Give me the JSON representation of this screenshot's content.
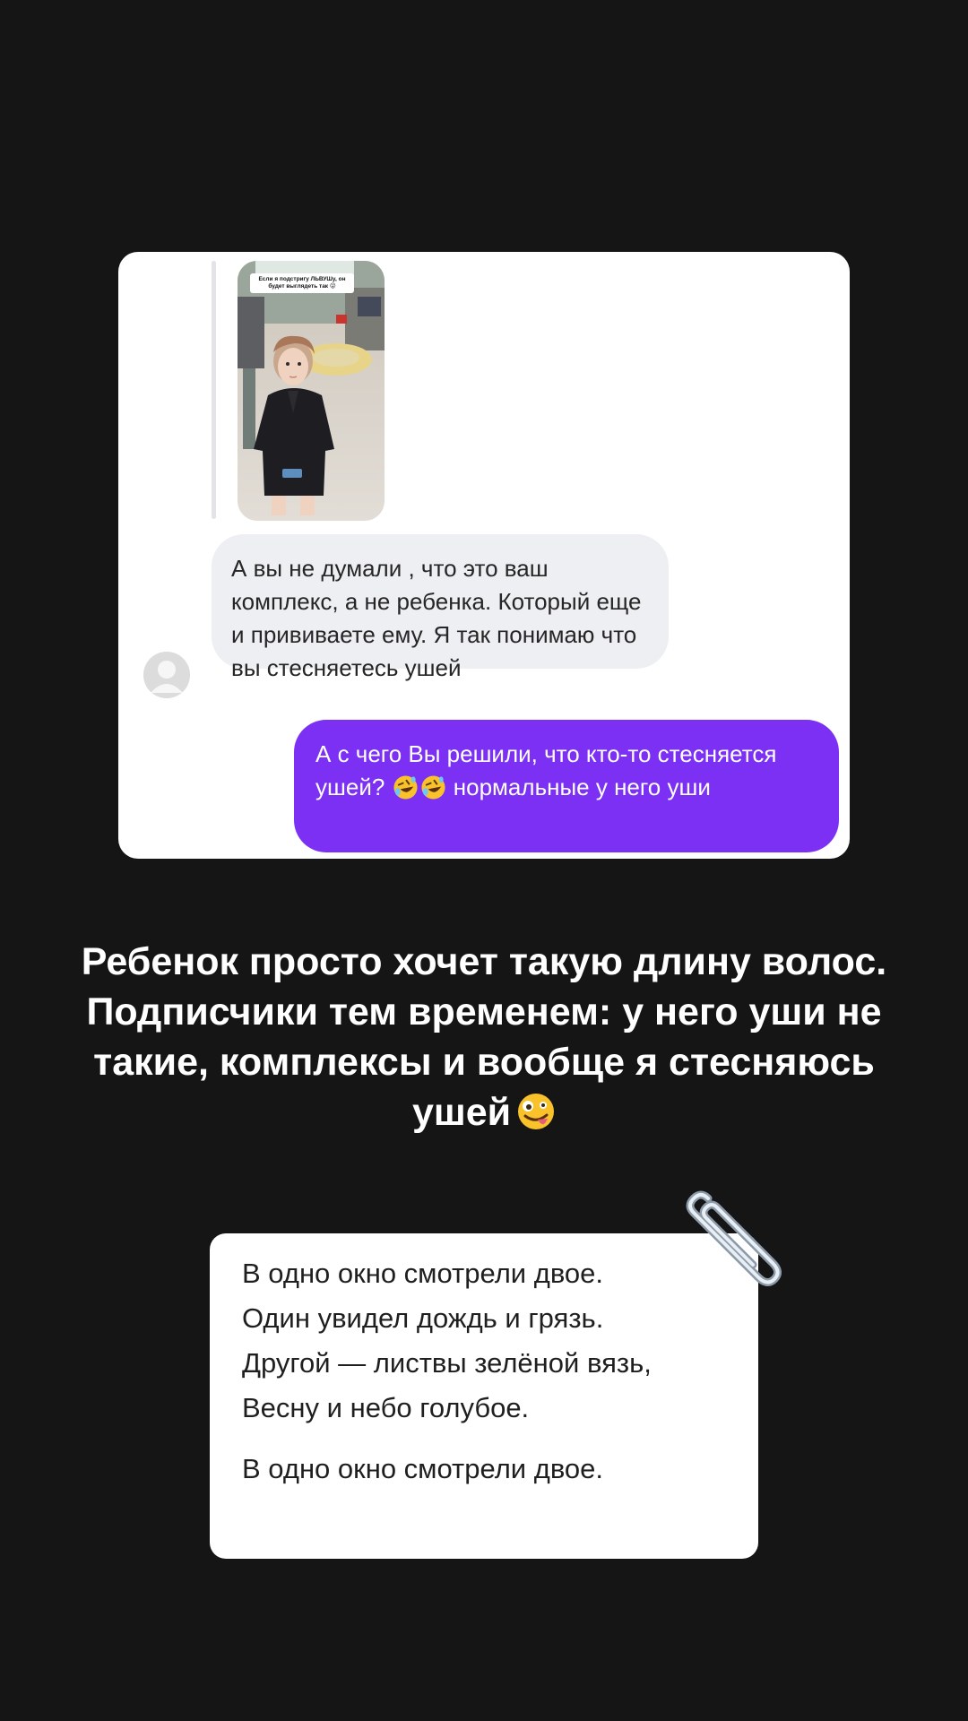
{
  "chat": {
    "story_preview_caption": "Если я подстригу ЛЬВУШу, он будет выглядеть так 😜",
    "incoming_message": "А вы не думали , что это ваш комплекс, а не ребенка. Который еще и прививаете ему. Я так понимаю что вы стесняетесь ушей",
    "outgoing_message": {
      "part1": "А с чего Вы решили, что кто-то стесняется ушей?",
      "emoji": [
        "rolling-on-floor-laughing",
        "rolling-on-floor-laughing"
      ],
      "part2": "нормальные у него уши"
    },
    "colors": {
      "outgoing_bubble": "#7b30f4",
      "incoming_bubble": "#eeeff3"
    }
  },
  "caption": {
    "text": "Ребенок просто хочет такую длину волос. Подписчики тем временем: у него уши не такие, комплексы и вообще  я стесняюсь ушей",
    "emoji": "zany-face"
  },
  "poem": {
    "lines": [
      "В одно окно смотрели двое.",
      "Один увидел дождь и грязь.",
      "Другой — листвы зелёной вязь,",
      "Весну и небо голубое.",
      "В одно окно смотрели двое."
    ],
    "decoration_icon": "paperclip"
  },
  "colors": {
    "background": "#151515",
    "card": "#ffffff"
  }
}
